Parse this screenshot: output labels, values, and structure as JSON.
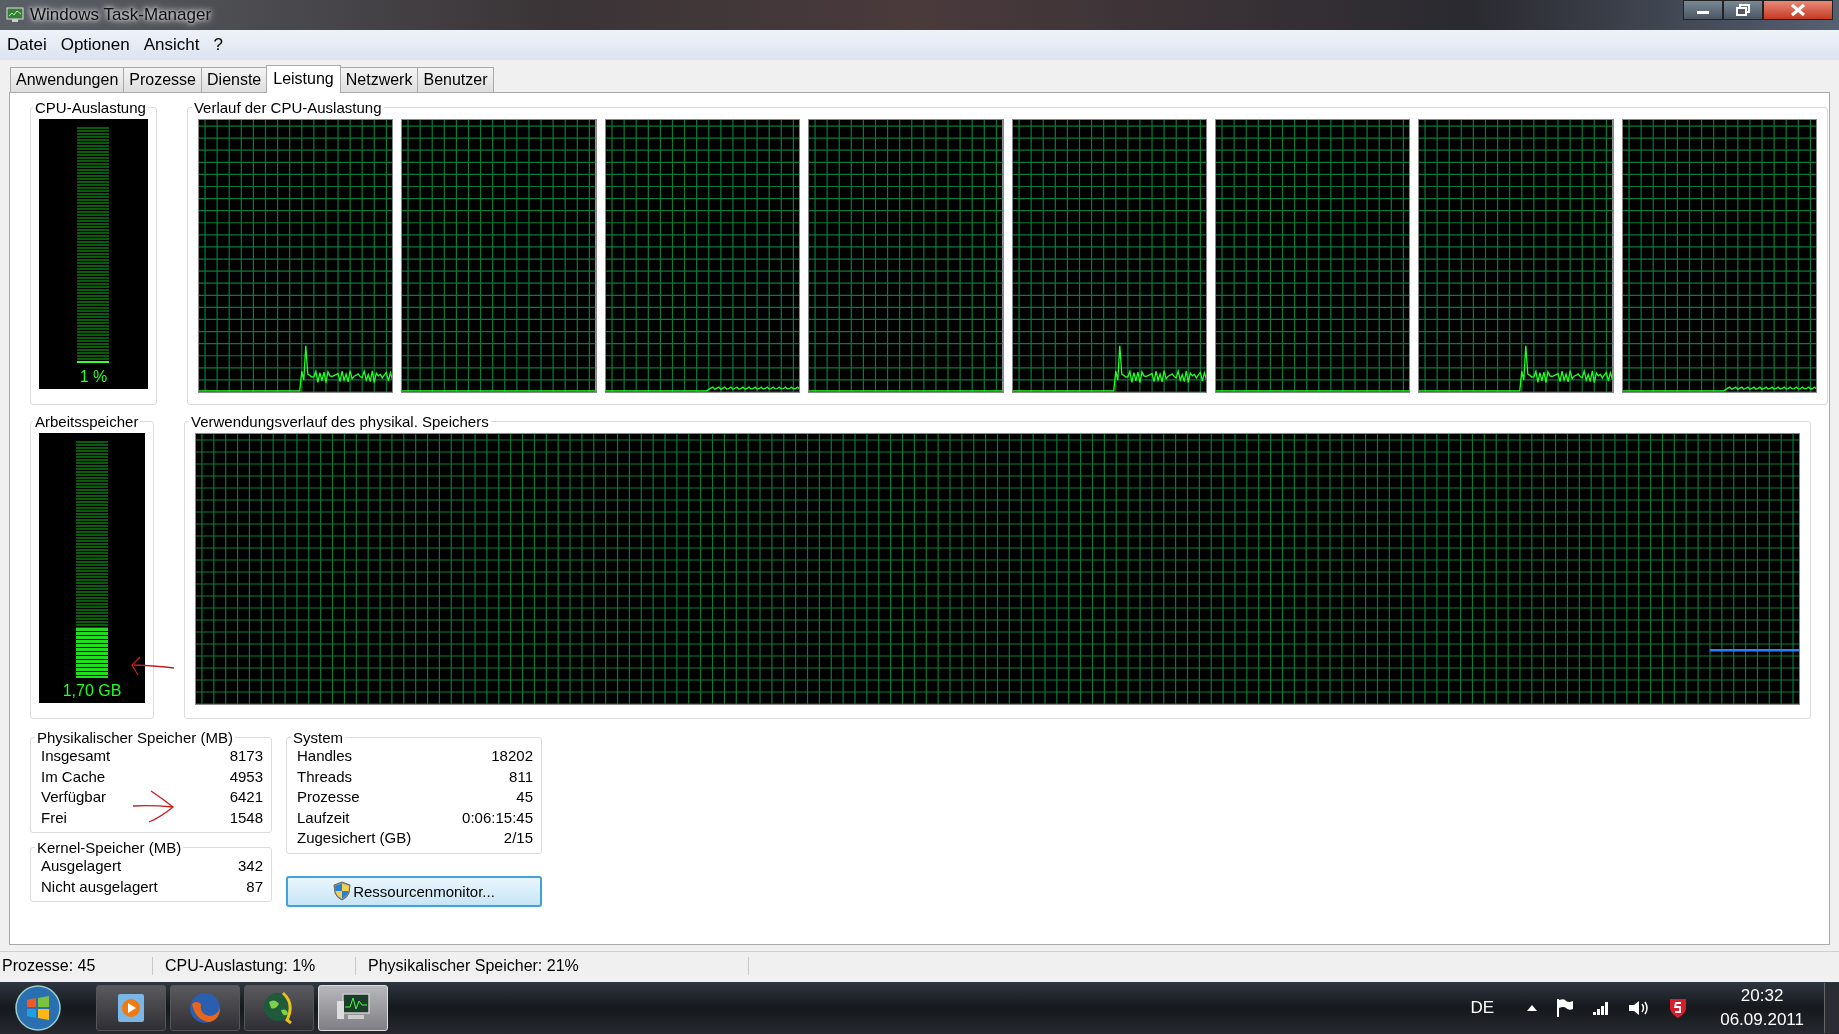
{
  "window": {
    "title": "Windows Task-Manager"
  },
  "menu": [
    "Datei",
    "Optionen",
    "Ansicht",
    "?"
  ],
  "tabs": [
    {
      "label": "Anwendungen",
      "selected": false
    },
    {
      "label": "Prozesse",
      "selected": false
    },
    {
      "label": "Dienste",
      "selected": false
    },
    {
      "label": "Leistung",
      "selected": true
    },
    {
      "label": "Netzwerk",
      "selected": false
    },
    {
      "label": "Benutzer",
      "selected": false
    }
  ],
  "cpu_usage": {
    "title": "CPU-Auslastung",
    "reading": "1 %",
    "level": 0.01
  },
  "cpu_history": {
    "title": "Verlauf der CPU-Auslastung",
    "cores": [
      {
        "kind": "spike"
      },
      {
        "kind": "flat"
      },
      {
        "kind": "ripple"
      },
      {
        "kind": "flat"
      },
      {
        "kind": "spike"
      },
      {
        "kind": "flat"
      },
      {
        "kind": "spike"
      },
      {
        "kind": "ripple"
      }
    ]
  },
  "memory_usage": {
    "title": "Arbeitsspeicher",
    "reading": "1,70 GB",
    "level": 0.21
  },
  "memory_history": {
    "title": "Verwendungsverlauf des physikal. Speichers"
  },
  "physical_memory": {
    "title": "Physikalischer Speicher (MB)",
    "rows": [
      {
        "label": "Insgesamt",
        "value": "8173"
      },
      {
        "label": "Im Cache",
        "value": "4953"
      },
      {
        "label": "Verfügbar",
        "value": "6421"
      },
      {
        "label": "Frei",
        "value": "1548"
      }
    ]
  },
  "kernel_memory": {
    "title": "Kernel-Speicher (MB)",
    "rows": [
      {
        "label": "Ausgelagert",
        "value": "342"
      },
      {
        "label": "Nicht ausgelagert",
        "value": "87"
      }
    ]
  },
  "system": {
    "title": "System",
    "rows": [
      {
        "label": "Handles",
        "value": "18202"
      },
      {
        "label": "Threads",
        "value": "811"
      },
      {
        "label": "Prozesse",
        "value": "45"
      },
      {
        "label": "Laufzeit",
        "value": "0:06:15:45"
      },
      {
        "label": "Zugesichert (GB)",
        "value": "2/15"
      }
    ]
  },
  "resource_monitor_button": "Ressourcenmonitor...",
  "status_bar": [
    "Prozesse: 45",
    "CPU-Auslastung: 1%",
    "Physikalischer Speicher: 21%"
  ],
  "taskbar": {
    "apps": [
      {
        "kind": "media-player",
        "selected": false
      },
      {
        "kind": "browser",
        "selected": false
      },
      {
        "kind": "globe",
        "selected": false
      },
      {
        "kind": "monitor",
        "selected": true
      }
    ],
    "language": "DE",
    "time": "20:32",
    "date": "06.09.2011"
  }
}
